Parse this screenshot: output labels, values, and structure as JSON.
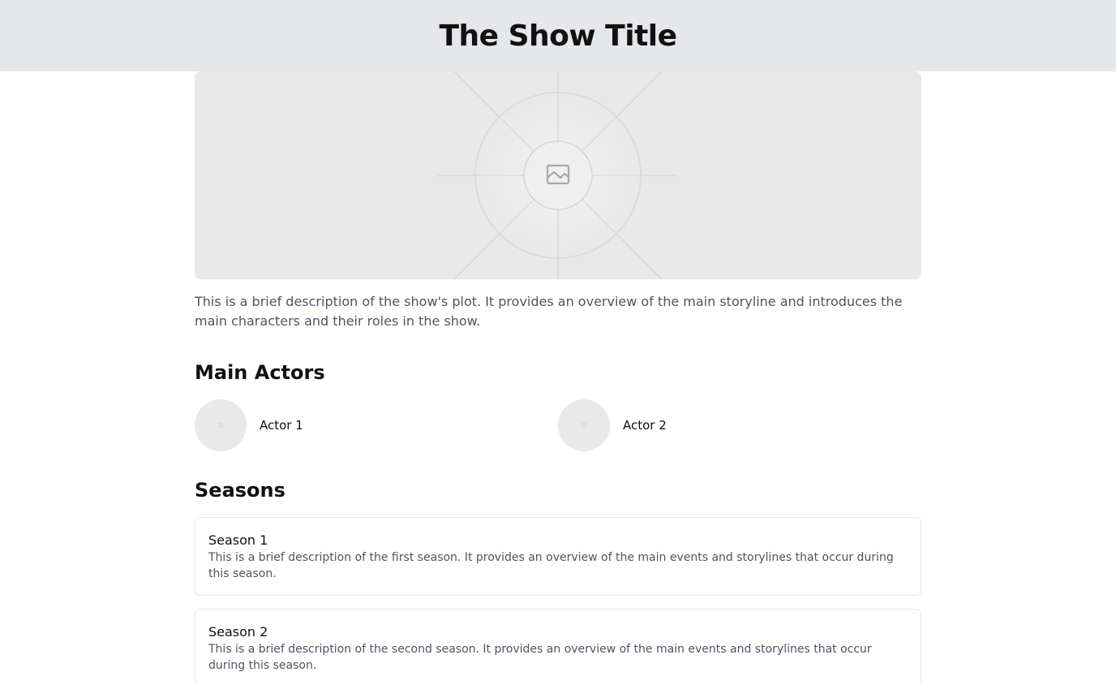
{
  "header": {
    "title": "The Show Title"
  },
  "hero": {
    "icon": "image-placeholder-icon"
  },
  "description": "This is a brief description of the show's plot. It provides an overview of the main storyline and introduces the main characters and their roles in the show.",
  "actors": {
    "title": "Main Actors",
    "items": [
      {
        "name": "Actor 1"
      },
      {
        "name": "Actor 2"
      }
    ]
  },
  "seasons": {
    "title": "Seasons",
    "items": [
      {
        "title": "Season 1",
        "description": "This is a brief description of the first season. It provides an overview of the main events and storylines that occur during this season."
      },
      {
        "title": "Season 2",
        "description": "This is a brief description of the second season. It provides an overview of the main events and storylines that occur during this season."
      }
    ]
  },
  "colors": {
    "header_bg": "#e5e7eb",
    "placeholder_bg": "#e8e8e8",
    "body_text": "#4b5563",
    "card_border": "#e5e7eb"
  }
}
